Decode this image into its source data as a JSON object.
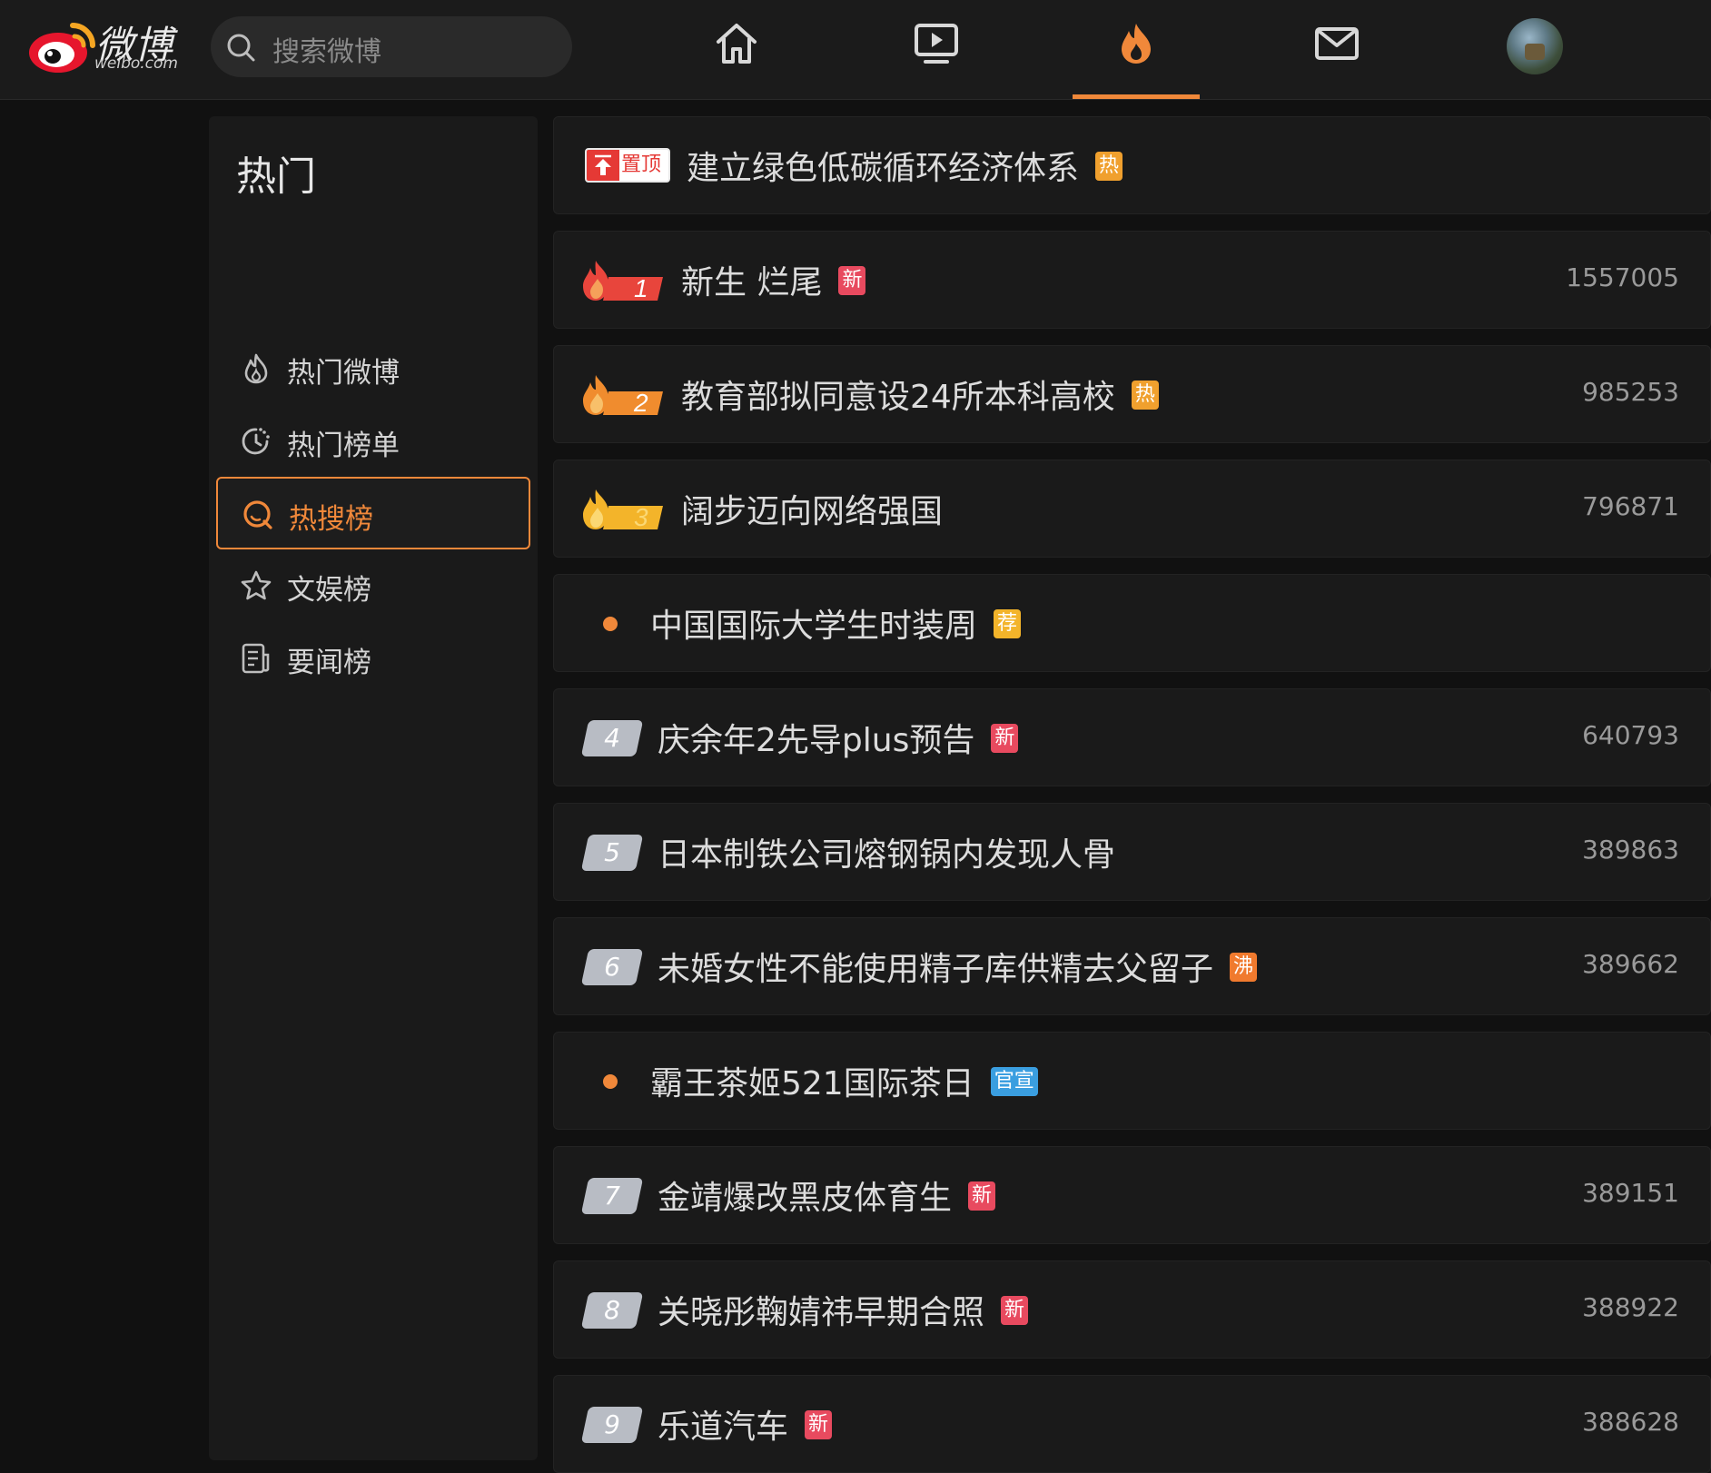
{
  "app": {
    "logo_text": "微博",
    "logo_sub": "weibo.com",
    "search_placeholder": "搜索微博",
    "accent": "#f0883a",
    "nav": [
      {
        "icon": "home-icon"
      },
      {
        "icon": "video-icon"
      },
      {
        "icon": "hot-fire-icon",
        "active": true
      },
      {
        "icon": "mail-icon"
      },
      {
        "icon": "avatar"
      }
    ]
  },
  "sidebar": {
    "title": "热门",
    "items": [
      {
        "label": "热门微博",
        "icon": "flame-outline-icon",
        "active": false
      },
      {
        "label": "热门榜单",
        "icon": "clock-chart-icon",
        "active": false
      },
      {
        "label": "热搜榜",
        "icon": "search-circle-icon",
        "active": true
      },
      {
        "label": "文娱榜",
        "icon": "star-icon",
        "active": false
      },
      {
        "label": "要闻榜",
        "icon": "newspaper-icon",
        "active": false
      }
    ]
  },
  "list": {
    "pinned": {
      "badge": "置顶",
      "title": "建立绿色低碳循环经济体系",
      "tag": "热",
      "tag_color": "#f0a02e"
    },
    "rows": [
      {
        "rank": "1",
        "title": "新生 烂尾",
        "tag": "新",
        "tag_color": "#e84a5f",
        "count": "1557005",
        "rank_color": "#e8453c"
      },
      {
        "rank": "2",
        "title": "教育部拟同意设24所本科高校",
        "tag": "热",
        "tag_color": "#f0a02e",
        "count": "985253",
        "rank_color": "#f08c2e"
      },
      {
        "rank": "3",
        "title": "阔步迈向网络强国",
        "tag": "",
        "count": "796871",
        "rank_color": "#f3b42a"
      },
      {
        "rank": "",
        "dot": true,
        "title": "中国国际大学生时装周",
        "tag": "荐",
        "tag_color": "#f3b42a",
        "count": ""
      },
      {
        "rank": "4",
        "title": "庆余年2先导plus预告",
        "tag": "新",
        "tag_color": "#e84a5f",
        "count": "640793"
      },
      {
        "rank": "5",
        "title": "日本制铁公司熔钢锅内发现人骨",
        "tag": "",
        "count": "389863"
      },
      {
        "rank": "6",
        "title": "未婚女性不能使用精子库供精去父留子",
        "tag": "沸",
        "tag_color": "#f07a2e",
        "count": "389662"
      },
      {
        "rank": "",
        "dot": true,
        "title": "霸王茶姬521国际茶日",
        "tag": "官宣",
        "tag_color": "#3a9ee0",
        "count": ""
      },
      {
        "rank": "7",
        "title": "金靖爆改黑皮体育生",
        "tag": "新",
        "tag_color": "#e84a5f",
        "count": "389151"
      },
      {
        "rank": "8",
        "title": "关晓彤鞠婧祎早期合照",
        "tag": "新",
        "tag_color": "#e84a5f",
        "count": "388922"
      },
      {
        "rank": "9",
        "title": "乐道汽车",
        "tag": "新",
        "tag_color": "#e84a5f",
        "count": "388628"
      }
    ]
  }
}
